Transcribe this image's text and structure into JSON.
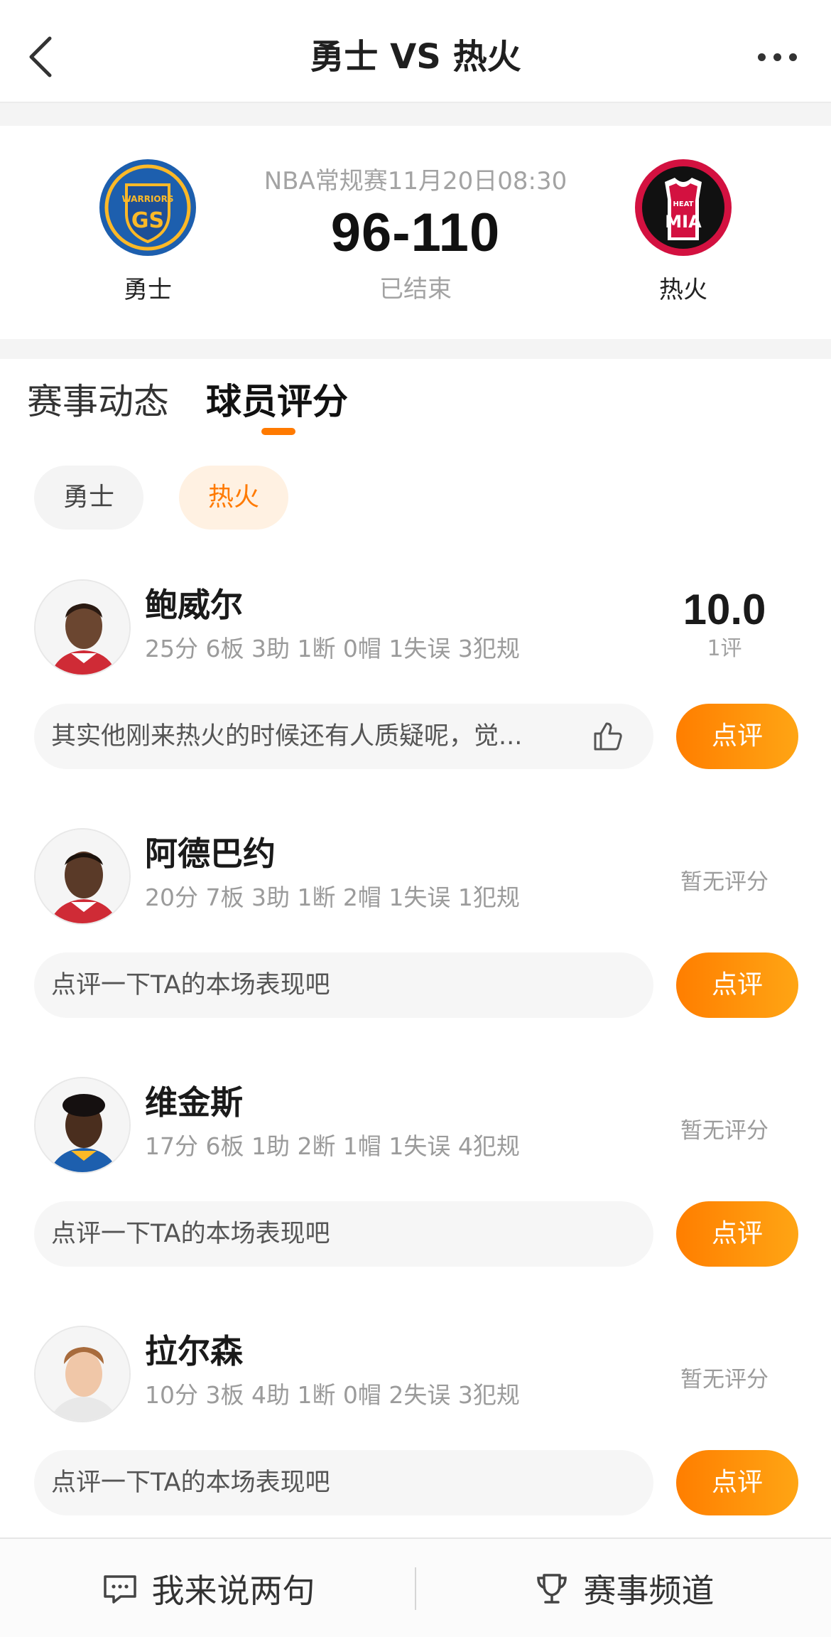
{
  "nav": {
    "title": "勇士 VS 热火"
  },
  "match": {
    "league_time": "NBA常规赛11月20日08:30",
    "score": "96-110",
    "status": "已结束",
    "home": {
      "name": "勇士",
      "logo_top": "WARRIORS",
      "logo_main": "GS"
    },
    "away": {
      "name": "热火",
      "logo_top": "HEAT",
      "logo_main": "MIA"
    }
  },
  "tabs": [
    {
      "label": "赛事动态"
    },
    {
      "label": "球员评分"
    }
  ],
  "team_filters": [
    {
      "label": "勇士"
    },
    {
      "label": "热火"
    }
  ],
  "players": [
    {
      "name": "鲍威尔",
      "stats": "25分 6板 3助 1断 0帽 1失误 3犯规",
      "rating": "10.0",
      "rating_count": "1评",
      "comment": "其实他刚来热火的时候还有人质疑呢，觉...",
      "button": "点评"
    },
    {
      "name": "阿德巴约",
      "stats": "20分 7板 3助 1断 2帽 1失误 1犯规",
      "rating_none": "暂无评分",
      "comment": "点评一下TA的本场表现吧",
      "button": "点评"
    },
    {
      "name": "维金斯",
      "stats": "17分 6板 1助 2断 1帽 1失误 4犯规",
      "rating_none": "暂无评分",
      "comment": "点评一下TA的本场表现吧",
      "button": "点评"
    },
    {
      "name": "拉尔森",
      "stats": "10分 3板 4助 1断 0帽 2失误 3犯规",
      "rating_none": "暂无评分",
      "comment": "点评一下TA的本场表现吧",
      "button": "点评"
    }
  ],
  "bottom": {
    "left_label": "我来说两句",
    "right_label": "赛事频道"
  },
  "colors": {
    "accent": "#ff7a00",
    "warriors_blue": "#1d5fae",
    "warriors_gold": "#fdb927",
    "heat_red": "#d31140"
  }
}
